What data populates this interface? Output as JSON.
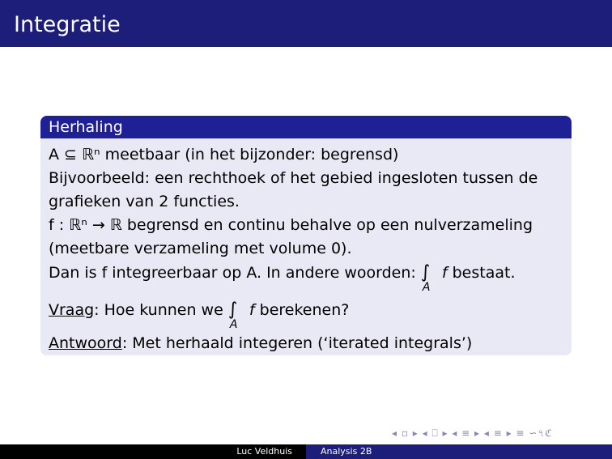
{
  "header": {
    "title": "Integratie"
  },
  "block": {
    "title": "Herhaling",
    "lines": {
      "l1": "A ⊆ ℝⁿ meetbaar (in het bijzonder: begrensd)",
      "l2": "Bijvoorbeeld: een rechthoek of het gebied ingesloten tussen de",
      "l3": "grafieken van 2 functies.",
      "l4": "f : ℝⁿ → ℝ begrensd en continu behalve op een nulverzameling",
      "l5": "(meetbare verzameling met volume 0).",
      "l6_text": "Dan is f integreerbaar op A. In andere woorden:",
      "l6_f": "f",
      "l6_end": "bestaat.",
      "integral_sign": "∫",
      "integral_sub": "A",
      "l7_label": "Vraag",
      "l7_text": ": Hoe kunnen we",
      "l7_f": "f",
      "l7_end": "berekenen?",
      "l8_label": "Antwoord",
      "l8_text": ": Met herhaald integeren (‘iterated integrals’)"
    }
  },
  "nav": {
    "symbols": "◂ ▫ ▸ ◂ ⎕ ▸ ◂ ≡ ▸ ◂ ≡ ▸ ≡ ∽৭ℭ"
  },
  "footer": {
    "author": "Luc Veldhuis",
    "course": "Analysis 2B"
  }
}
